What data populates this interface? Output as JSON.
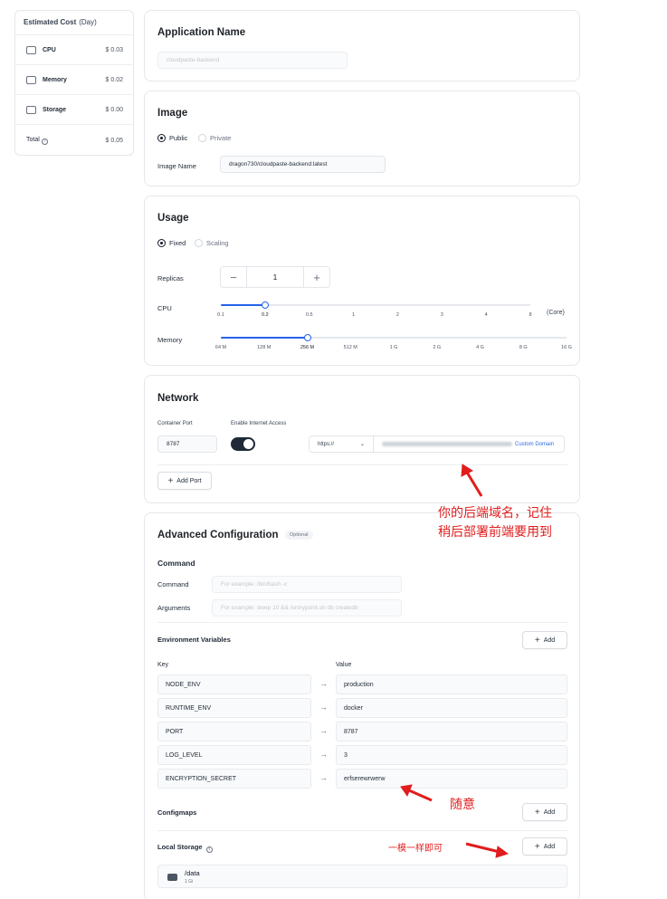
{
  "estimated_cost": {
    "title": "Estimated Cost",
    "unit": "(Day)",
    "rows": [
      {
        "label": "CPU",
        "value": "$ 0.03",
        "icon": "cpu-icon"
      },
      {
        "label": "Memory",
        "value": "$ 0.02",
        "icon": "memory-icon"
      },
      {
        "label": "Storage",
        "value": "$ 0.00",
        "icon": "storage-icon"
      }
    ],
    "total_label": "Total",
    "total_value": "$ 0.05"
  },
  "application": {
    "title": "Application Name",
    "name_placeholder": "cloudpaste-backend"
  },
  "image": {
    "title": "Image",
    "options": [
      "Public",
      "Private"
    ],
    "selected": "Public",
    "name_label": "Image Name",
    "name_value": "dragon730/cloudpaste-backend:latest"
  },
  "usage": {
    "title": "Usage",
    "modes": [
      "Fixed",
      "Scaling"
    ],
    "selected_mode": "Fixed",
    "replicas_label": "Replicas",
    "replicas_value": "1",
    "minus": "−",
    "plus": "+",
    "cpu_label": "CPU",
    "cpu_ticks": [
      "0.1",
      "0.2",
      "0.5",
      "1",
      "2",
      "3",
      "4",
      "8"
    ],
    "cpu_selected_index": 1,
    "cpu_unit": "(Core)",
    "memory_label": "Memory",
    "memory_ticks": [
      "64 M",
      "128 M",
      "256 M",
      "512 M",
      "1 G",
      "2 G",
      "4 G",
      "8 G",
      "16 G"
    ],
    "memory_selected_index": 2
  },
  "network": {
    "title": "Network",
    "port_label": "Container Port",
    "port_value": "8787",
    "internet_label": "Enable Internet Access",
    "internet_enabled": true,
    "protocol": "https://",
    "custom_domain": "Custom Domain",
    "add_port": "Add Port"
  },
  "annotations": {
    "domain_note_line1": "你的后端域名，记住",
    "domain_note_line2": "稍后部署前端要用到",
    "secret_note": "随意",
    "storage_note": "一模一样即可",
    "color": "#e11d1d"
  },
  "advanced": {
    "title": "Advanced Configuration",
    "badge": "Optional",
    "command_section": "Command",
    "command_label": "Command",
    "command_placeholder": "For example: /bin/bash -c",
    "arguments_label": "Arguments",
    "arguments_placeholder": "For example: sleep 10 && /entrypoint.sh db createdb",
    "env_title": "Environment Variables",
    "add": "Add",
    "key_header": "Key",
    "value_header": "Value",
    "env": [
      {
        "key": "NODE_ENV",
        "value": "production"
      },
      {
        "key": "RUNTIME_ENV",
        "value": "docker"
      },
      {
        "key": "PORT",
        "value": "8787"
      },
      {
        "key": "LOG_LEVEL",
        "value": "3"
      },
      {
        "key": "ENCRYPTION_SECRET",
        "value": "erfserewrwerw"
      }
    ],
    "configmaps_title": "Configmaps",
    "local_storage_title": "Local Storage",
    "storage_path": "/data",
    "storage_size": "1 Gi"
  }
}
